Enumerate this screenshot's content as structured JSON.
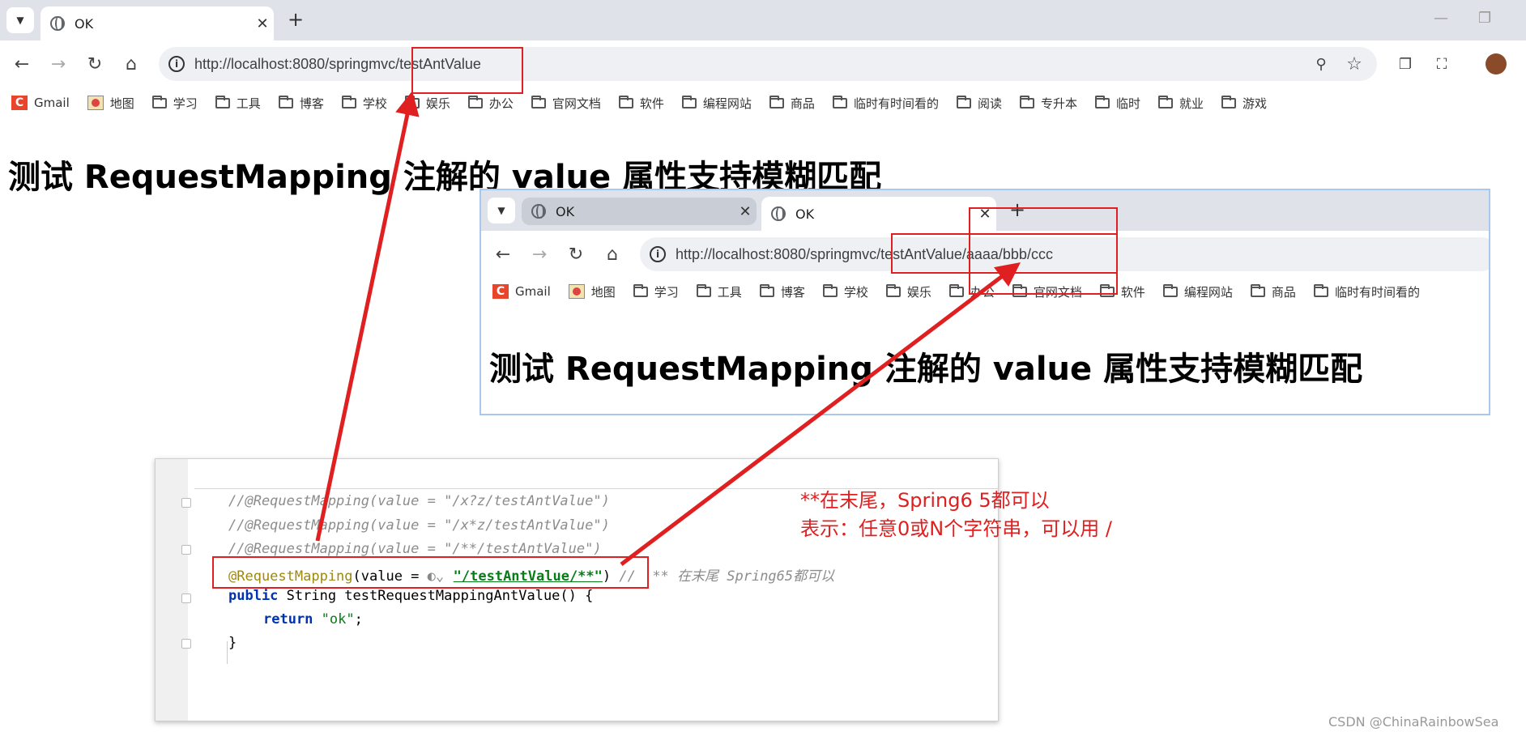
{
  "browser": {
    "tab_title": "OK",
    "url": "http://localhost:8080/springmvc/testAntValue",
    "bookmarks": [
      "Gmail",
      "地图",
      "学习",
      "工具",
      "博客",
      "学校",
      "娱乐",
      "办公",
      "官网文档",
      "软件",
      "编程网站",
      "商品",
      "临时有时间看的",
      "阅读",
      "专升本",
      "临时",
      "就业",
      "游戏"
    ],
    "heading": "测试 RequestMapping 注解的 value 属性支持模糊匹配"
  },
  "inner_browser": {
    "tab1_title": "OK",
    "tab2_title": "OK",
    "url": "http://localhost:8080/springmvc/testAntValue/aaaa/bbb/ccc",
    "bookmarks": [
      "Gmail",
      "地图",
      "学习",
      "工具",
      "博客",
      "学校",
      "娱乐",
      "办公",
      "官网文档",
      "软件",
      "编程网站",
      "商品",
      "临时有时间看的"
    ],
    "heading": "测试 RequestMapping 注解的 value 属性支持模糊匹配"
  },
  "code": {
    "line1": "//@RequestMapping(value = \"/x?z/testAntValue\")",
    "line2": "//@RequestMapping(value = \"/x*z/testAntValue\")",
    "line3": "//@RequestMapping(value = \"/**/testAntValue\")",
    "line4_ann": "@RequestMapping",
    "line4_open": "(value = ",
    "line4_str": "\"/testAntValue/**\"",
    "line4_close": ")",
    "line4_comment": " //  ** 在末尾 Spring65都可以",
    "line5_kw": "public",
    "line5_rest": " String testRequestMappingAntValue() {",
    "line6_kw": "return",
    "line6_str": "\"ok\"",
    "line6_end": ";",
    "line7": "}"
  },
  "notes": {
    "line1": "**在末尾，Spring6 5都可以",
    "line2": "表示：任意0或N个字符串，可以用 /"
  },
  "watermark": "CSDN @ChinaRainbowSea",
  "colors": {
    "annotation_red": "#e02020",
    "inner_border": "#a9c8f0"
  }
}
